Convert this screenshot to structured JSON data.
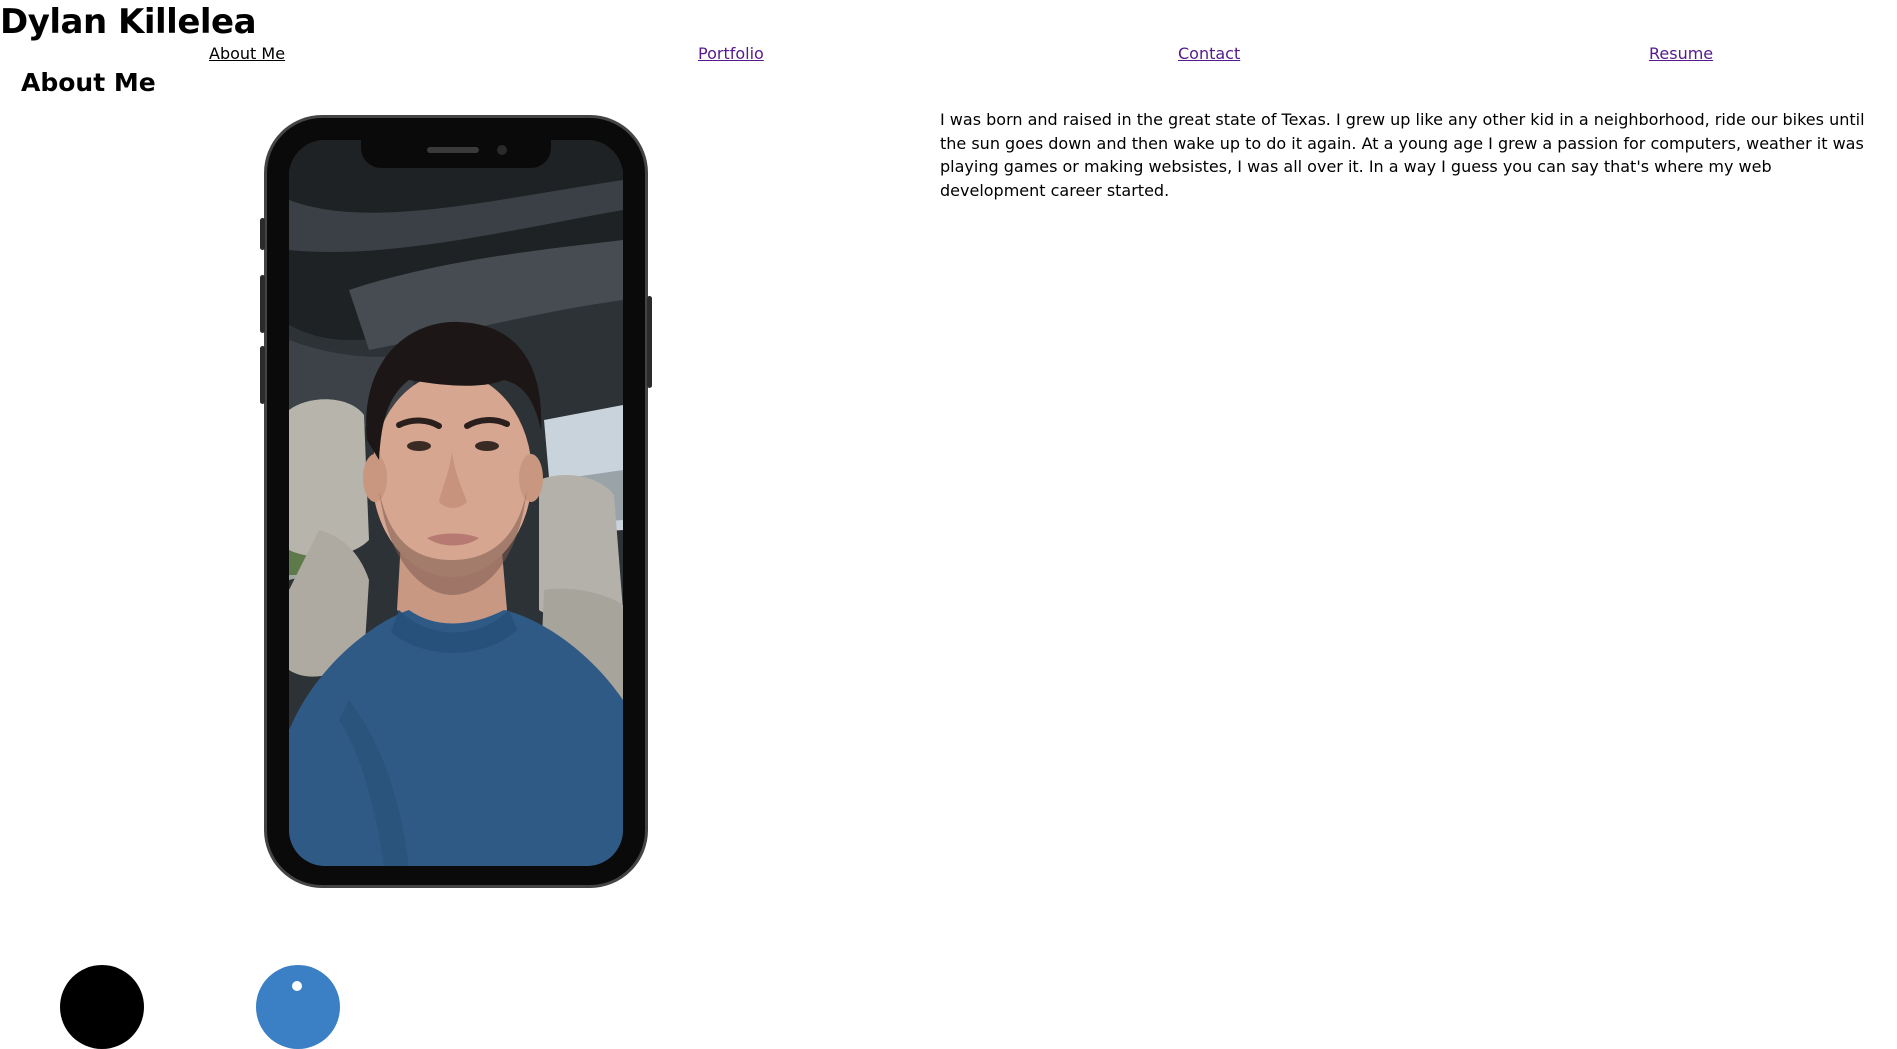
{
  "header": {
    "site_title": "Dylan Killelea"
  },
  "nav": {
    "items": [
      {
        "label": "About Me",
        "state": "current"
      },
      {
        "label": "Portfolio",
        "state": "visited"
      },
      {
        "label": "Contact",
        "state": "visited"
      },
      {
        "label": "Resume",
        "state": "visited"
      }
    ],
    "link_color_visited": "#551a8b",
    "link_color_current": "#000000"
  },
  "main": {
    "heading": "About Me",
    "bio": "I was born and raised in the great state of Texas. I grew up like any other kid in a neighborhood, ride our bikes until the sun goes down and then wake up to do it again. At a young age I grew a passion for computers, weather it was playing games or making websistes, I was all over it. In a way I guess you can say that's where my web development career started.",
    "photo": {
      "icon": "phone-mockup-selfie"
    }
  },
  "footer": {
    "social_icons": [
      {
        "icon": "github-icon",
        "color": "#000000"
      },
      {
        "icon": "linkedin-icon",
        "color": "#3b7fc4"
      }
    ]
  }
}
